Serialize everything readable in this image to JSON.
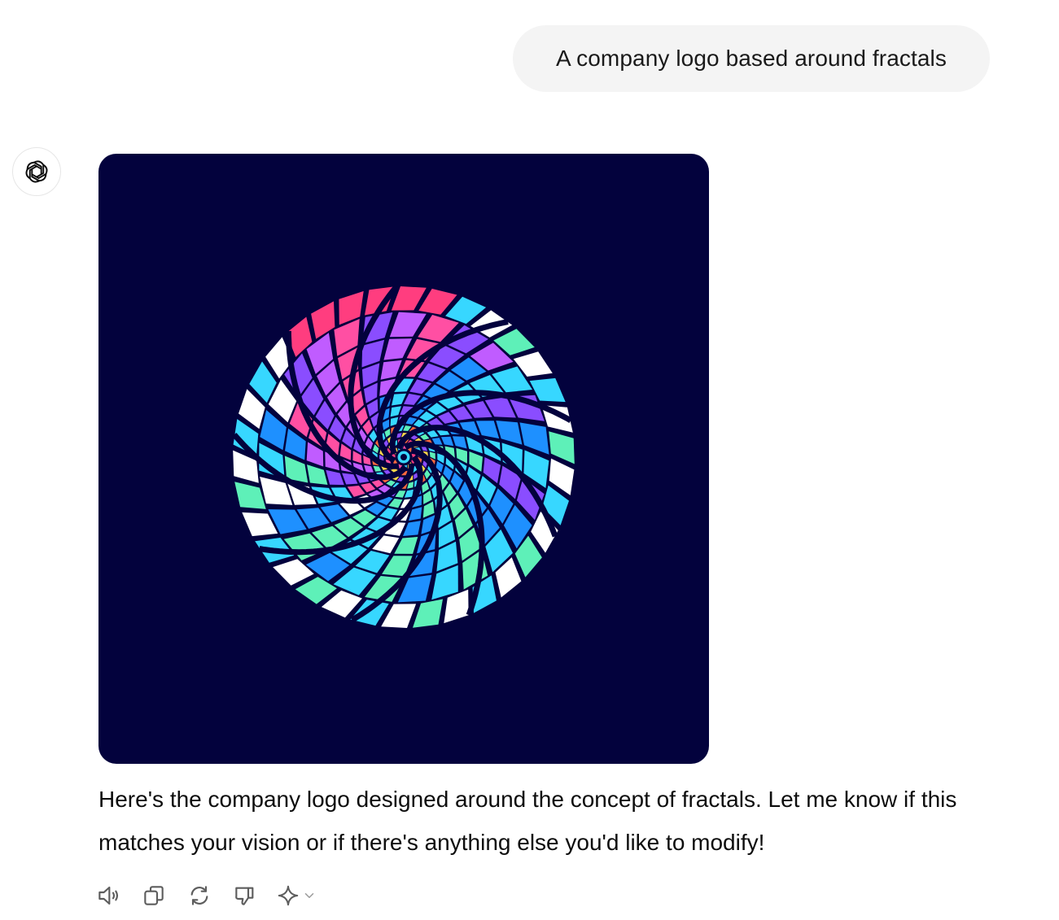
{
  "user_message": {
    "text": "A company logo based around fractals"
  },
  "assistant": {
    "avatar_icon": "openai-logo-icon",
    "image": {
      "background_color": "#03023d",
      "palette": [
        "#ffffff",
        "#5ef0b8",
        "#37d7ff",
        "#1e90ff",
        "#8a4dff",
        "#c05cff",
        "#ff3d7f",
        "#ff4fa3",
        "#ffd84a",
        "#ff6a3d"
      ]
    },
    "reply_text": "Here's the company logo designed around the concept of fractals. Let me know if this matches your vision or if there's anything else you'd like to modify!"
  },
  "actions": [
    {
      "name": "read-aloud-button",
      "icon": "speaker-icon"
    },
    {
      "name": "copy-button",
      "icon": "copy-icon"
    },
    {
      "name": "regenerate-button",
      "icon": "refresh-icon"
    },
    {
      "name": "bad-response-button",
      "icon": "thumbs-down-icon"
    },
    {
      "name": "model-switcher-button",
      "icon": "sparkle-icon"
    }
  ]
}
